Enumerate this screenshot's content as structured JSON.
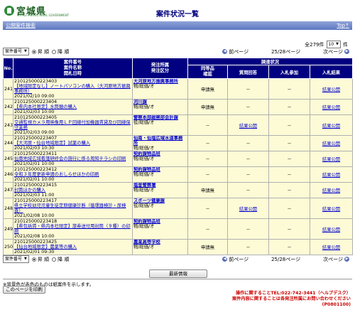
{
  "header": {
    "logo_text": "宮城県",
    "logo_sub": "MIYAGI PREFECTURAL GOVERNMENT",
    "page_title": "案件状況一覧"
  },
  "nav": {
    "breadcrumb": "公開案件検索",
    "top_link": "Top"
  },
  "summary": {
    "total_label": "全279件",
    "page_size": "10",
    "page_size_suffix": "件"
  },
  "controls": {
    "sort_select": "案件番号",
    "asc_label": "昇 順",
    "desc_label": "降 順",
    "prev_label": "前ページ",
    "page_info": "25/28ページ",
    "next_label": "次ページ"
  },
  "table": {
    "headers": {
      "no": "No.",
      "case": "案件番号\n案件名称\n開札日時",
      "dept": "発注所属\n発注区分",
      "procedure": "調達状況",
      "entry": "同等品\n確認",
      "question": "質問回答",
      "join": "入札参加",
      "result": "入札結果"
    },
    "rows": [
      {
        "no": "241",
        "case_no": "210125000223403",
        "name": "【地域限定なし】ノートパソコンの購入（大河原地方振興事務所）",
        "date": "2021/02/10 09:00",
        "dept": "大河原地方振興事務所",
        "sec": "物/総価/オ",
        "entry": "申請無",
        "question": "－",
        "join": "－",
        "result": "結果公開"
      },
      {
        "no": "242",
        "case_no": "210125000223404",
        "name": "【県内本社限定】水筒類の購入",
        "date": "2021/02/03 10:00",
        "dept": "河川課",
        "sec": "物/総価/オ",
        "entry": "申請無",
        "question": "－",
        "join": "－",
        "result": "結果公開"
      },
      {
        "no": "243",
        "case_no": "210125000223405",
        "name": "交通監視カメラ用映像用ＬＰ回線付加機器賃貸及び回線保守業務",
        "date": "2021/02/03 09:00",
        "dept": "警察本部総務部会計課",
        "sec": "役/総価/オ",
        "entry": "－",
        "question": "結果公開",
        "join": "－",
        "result": "結果公開"
      },
      {
        "no": "244",
        "case_no": "210125000223407",
        "name": "【大河原・仙台地域限定】試薬の購入",
        "date": "2021/02/03 10:30",
        "dept": "仙南・仙塩広域水道事務所",
        "sec": "物/総価/オ",
        "entry": "－",
        "question": "－",
        "join": "－",
        "result": "結果公開"
      },
      {
        "no": "245",
        "case_no": "210125000223411",
        "name": "仙南地域広域看護研修会の施行に係る周知チラシの印刷",
        "date": "2021/02/01 10:00",
        "dept": "契約課物品班",
        "sec": "物/総価/オ",
        "entry": "－",
        "question": "－",
        "join": "－",
        "result": "結果公開"
      },
      {
        "no": "246",
        "case_no": "210125000223412",
        "name": "令和３年度更新申請のおしらせほかの印刷",
        "date": "2021/02/01 10:00",
        "dept": "契約課物品班",
        "sec": "物/総価/オ",
        "entry": "－",
        "question": "－",
        "join": "－",
        "result": "結果公開"
      },
      {
        "no": "247",
        "case_no": "210125000223415",
        "name": "封筒ほかの購入",
        "date": "2021/02/03 11:00",
        "dept": "塩釜警察署",
        "sec": "物/総価/オ",
        "entry": "申請無",
        "question": "－",
        "join": "－",
        "result": "結果公開"
      },
      {
        "no": "248",
        "case_no": "210125000223417",
        "name": "県立学校幼児児童生徒定期健康診断（循環器検診・尿検査）",
        "date": "2021/02/08 10:00",
        "dept": "スポーツ健康課",
        "sec": "役/総価/オ",
        "entry": "－",
        "question": "結果公開",
        "join": "－",
        "result": "結果公開"
      },
      {
        "no": "249",
        "case_no": "210125000223418",
        "name": "【県包括賃・県内本社限定】旅券送付用封筒（９種）の印刷",
        "date": "2021/02/08 10:00",
        "dept": "契約課物品班",
        "sec": "物/総価/オ",
        "entry": "－",
        "question": "－",
        "join": "－",
        "result": "結果公開"
      },
      {
        "no": "250",
        "case_no": "210125000223425",
        "name": "【仙台地域限定】農薬等の購入",
        "date": "2021/02/01 09:30",
        "dept": "農業高等学校",
        "sec": "物/総価/オ",
        "entry": "申請無",
        "question": "－",
        "join": "－",
        "result": "結果公開"
      }
    ]
  },
  "buttons": {
    "latest": "最新情報",
    "print": "このページを印刷"
  },
  "footer": {
    "note": "※背景色が赤色のものは紙案件を示します。",
    "contact1": "操作に関することTEL:022-742-3441（ヘルプデスク）",
    "contact2": "案件内容に関することは各発注所属にお問い合わせください",
    "code": "(P0801100)"
  }
}
